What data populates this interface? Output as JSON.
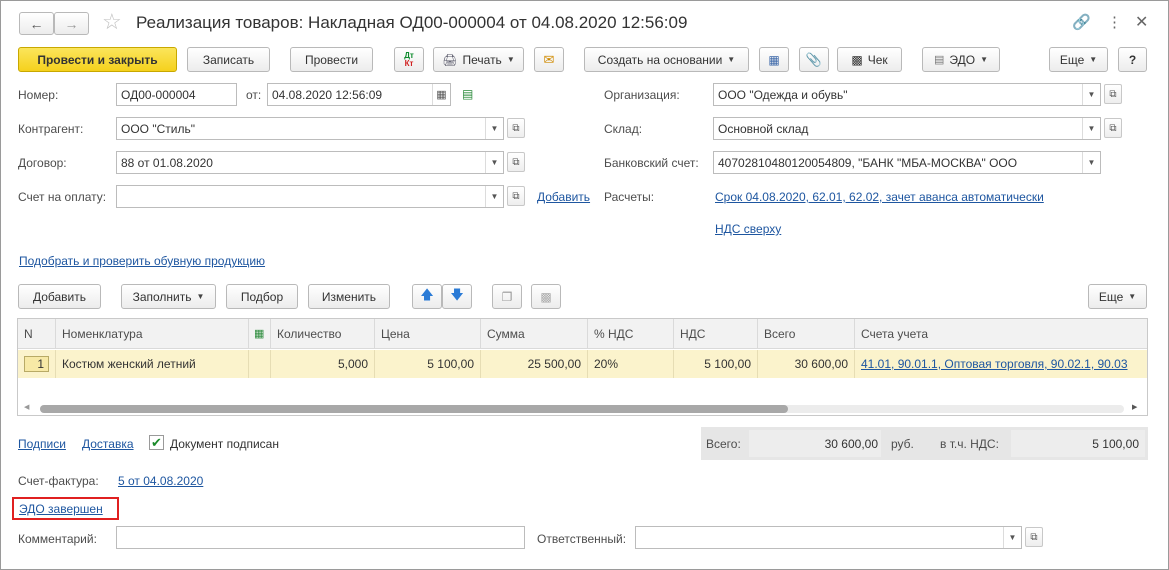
{
  "window": {
    "title": "Реализация товаров: Накладная ОД00-000004 от 04.08.2020 12:56:09",
    "back_icon": "arrow-left-icon",
    "forward_icon": "arrow-right-icon",
    "favorite_icon": "star-icon",
    "link_icon": "link-icon",
    "more_icon": "more-vert-icon",
    "close_icon": "close-icon"
  },
  "toolbar": {
    "post_close": "Провести и закрыть",
    "save": "Записать",
    "post": "Провести",
    "dt_kt_top": "Дт",
    "dt_kt_bottom": "Кт",
    "print": "Печать",
    "create_based": "Создать на основании",
    "check": "Чек",
    "edo": "ЭДО",
    "more": "Еще",
    "help": "?"
  },
  "header": {
    "number_label": "Номер:",
    "number_value": "ОД00-000004",
    "from_label": "от:",
    "date_value": "04.08.2020 12:56:09",
    "org_label": "Организация:",
    "org_value": "ООО \"Одежда и обувь\"",
    "contractor_label": "Контрагент:",
    "contractor_value": "ООО \"Стиль\"",
    "warehouse_label": "Склад:",
    "warehouse_value": "Основной склад",
    "contract_label": "Договор:",
    "contract_value": "88 от 01.08.2020",
    "bank_label": "Банковский счет:",
    "bank_value": "40702810480120054809, \"БАНК \"МБА-МОСКВА\" ООО",
    "invoice_pay_label": "Счет на оплату:",
    "invoice_pay_value": "",
    "add_link": "Добавить",
    "settlements_label": "Расчеты:",
    "settlements_link": "Срок 04.08.2020, 62.01, 62.02, зачет аванса автоматически",
    "vat_link": "НДС сверху",
    "shoes_link": "Подобрать и проверить обувную продукцию"
  },
  "table_toolbar": {
    "add": "Добавить",
    "fill": "Заполнить",
    "pick": "Подбор",
    "change": "Изменить",
    "more": "Еще"
  },
  "table": {
    "columns": [
      "N",
      "Номенклатура",
      "Количество",
      "Цена",
      "Сумма",
      "% НДС",
      "НДС",
      "Всего",
      "Счета учета"
    ],
    "rows": [
      {
        "n": "1",
        "item": "Костюм женский летний",
        "qty": "5,000",
        "price": "5 100,00",
        "sum": "25 500,00",
        "vat_rate": "20%",
        "vat": "5 100,00",
        "total": "30 600,00",
        "accounts": "41.01, 90.01.1, Оптовая торговля, 90.02.1, 90.03"
      }
    ]
  },
  "footer": {
    "signatures_link": "Подписи",
    "delivery_link": "Доставка",
    "doc_signed_label": "Документ подписан",
    "doc_signed_checked": true,
    "total_label": "Всего:",
    "total_value": "30 600,00",
    "currency": "руб.",
    "vat_incl_label": "в т.ч. НДС:",
    "vat_incl_value": "5 100,00",
    "invoice_label": "Счет-фактура:",
    "invoice_link": "5 от 04.08.2020",
    "edo_status_link": "ЭДО завершен",
    "comment_label": "Комментарий:",
    "comment_value": "",
    "responsible_label": "Ответственный:",
    "responsible_value": ""
  },
  "colors": {
    "primary_button": "#f5d11d",
    "link": "#1e56a0",
    "row_highlight": "#fbf3cc",
    "edo_highlight_border": "#e02020"
  }
}
